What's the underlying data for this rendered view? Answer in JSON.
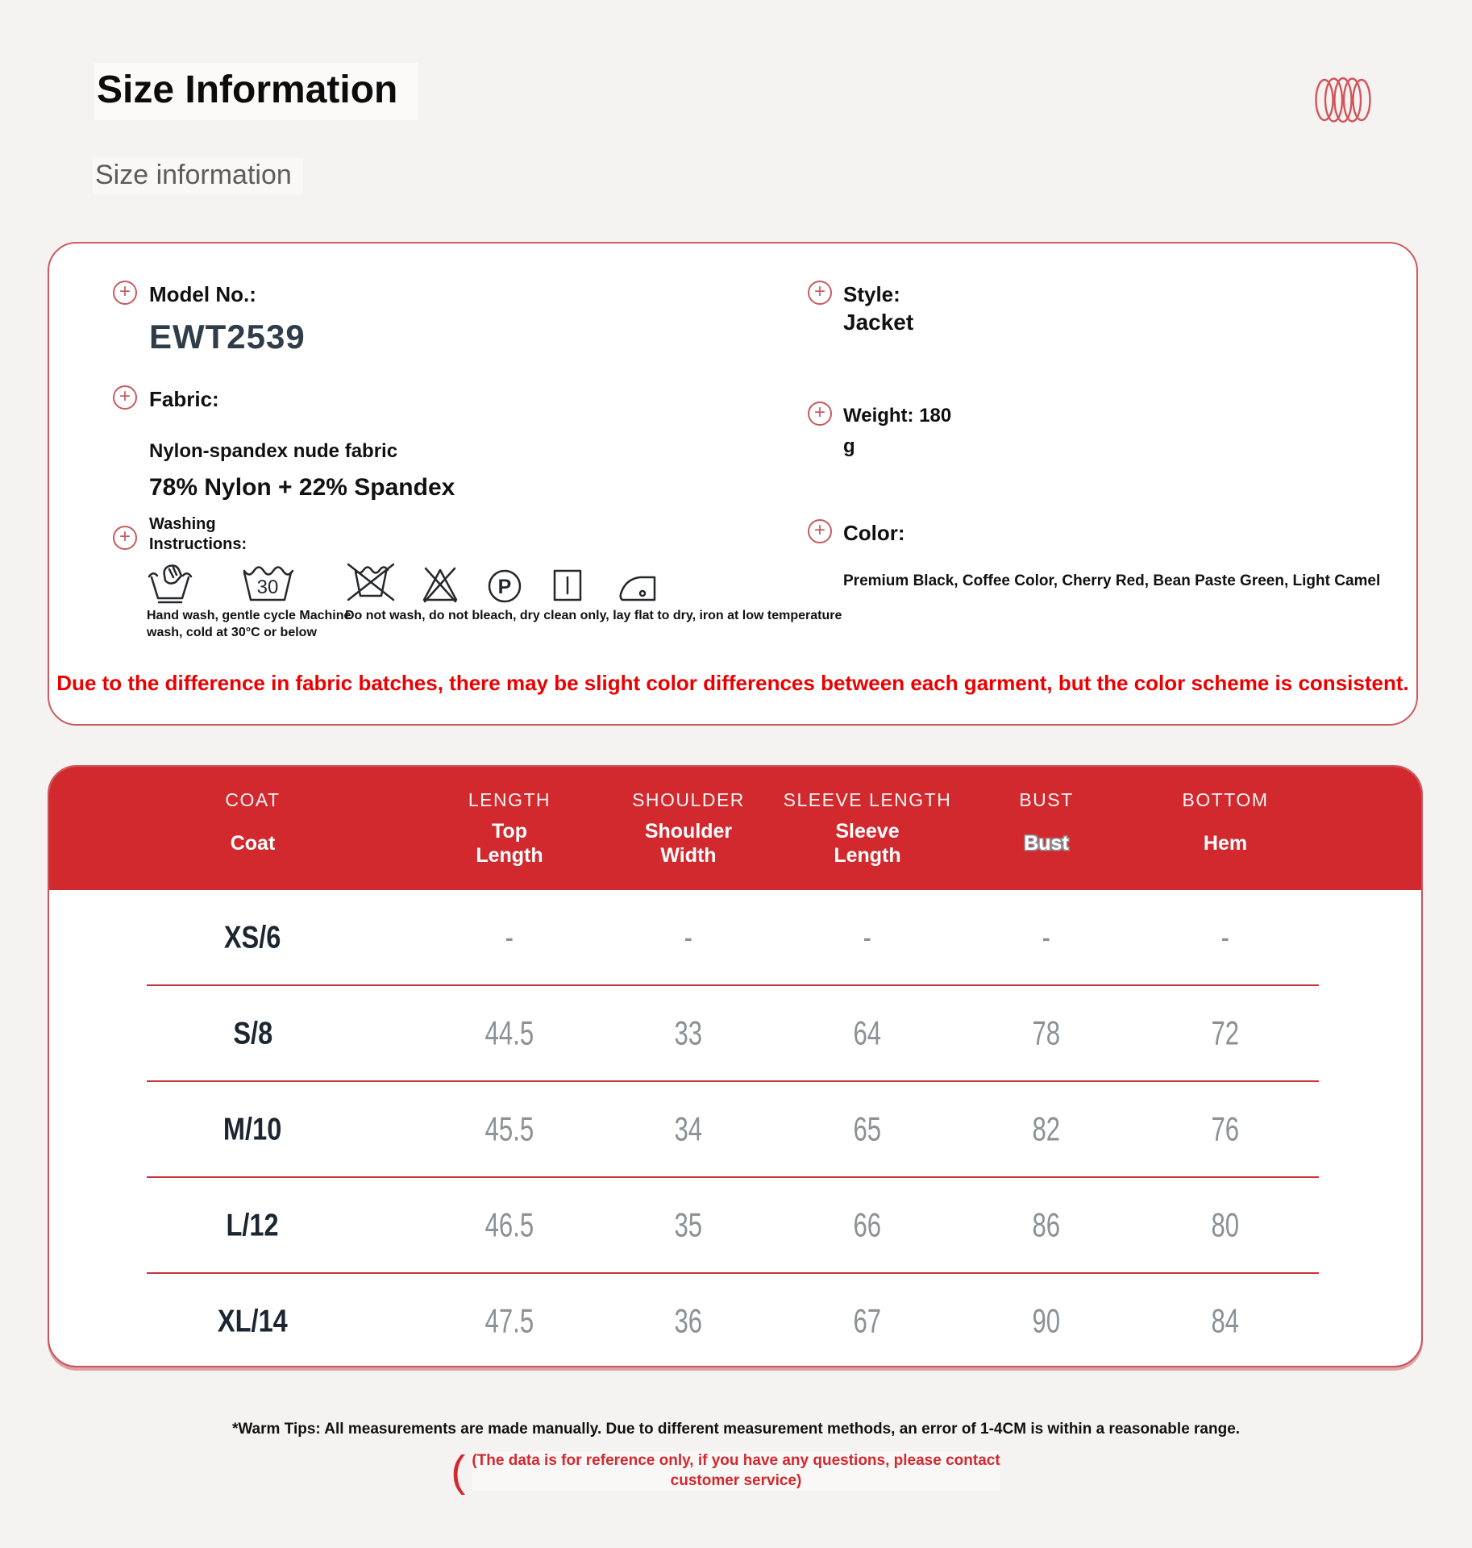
{
  "header": {
    "title": "Size Information",
    "subtitle": "Size information",
    "logo_icon": "coil-logo-icon"
  },
  "icons": {
    "plus": "+",
    "washing_icon_names": [
      "hand-wash-icon",
      "machine-wash-30-icon",
      "do-not-wash-icon",
      "do-not-bleach-icon",
      "dry-clean-p-icon",
      "drip-dry-icon",
      "iron-low-temp-icon"
    ]
  },
  "product_info": {
    "model": {
      "label": "Model No.:",
      "value": "EWT2539"
    },
    "style": {
      "label": "Style:",
      "value": "Jacket"
    },
    "fabric": {
      "label": "Fabric:",
      "description": "Nylon-spandex nude fabric",
      "composition": "78% Nylon + 22% Spandex"
    },
    "weight": {
      "label": "Weight: 180",
      "unit": "g"
    },
    "washing": {
      "label": "Washing Instructions:",
      "machine_wash_temp": "30",
      "dry_clean_letter": "P",
      "caption_left": "Hand wash, gentle cycle Machine wash, cold at 30°C or below",
      "caption_right": "Do not wash, do not bleach, dry clean only, lay flat to dry, iron at low temperature"
    },
    "color": {
      "label": "Color:",
      "value": "Premium Black, Coffee Color, Cherry Red, Bean Paste Green, Light Camel"
    },
    "disclaimer": "Due to the difference in fabric batches, there may be slight color differences between each garment, but the color scheme is consistent."
  },
  "size_table": {
    "columns": [
      {
        "en": "COAT",
        "sub": "Coat"
      },
      {
        "en": "LENGTH",
        "sub": "Top Length"
      },
      {
        "en": "SHOULDER",
        "sub": "Shoulder Width"
      },
      {
        "en": "SLEEVE LENGTH",
        "sub": "Sleeve Length"
      },
      {
        "en": "BUST",
        "sub": "Bust"
      },
      {
        "en": "BOTTOM",
        "sub": "Hem"
      }
    ],
    "rows": [
      {
        "size": "XS/6",
        "values": [
          "-",
          "-",
          "-",
          "-",
          "-"
        ]
      },
      {
        "size": "S/8",
        "values": [
          "44.5",
          "33",
          "64",
          "78",
          "72"
        ]
      },
      {
        "size": "M/10",
        "values": [
          "45.5",
          "34",
          "65",
          "82",
          "76"
        ]
      },
      {
        "size": "L/12",
        "values": [
          "46.5",
          "35",
          "66",
          "86",
          "80"
        ]
      },
      {
        "size": "XL/14",
        "values": [
          "47.5",
          "36",
          "67",
          "90",
          "84"
        ]
      }
    ]
  },
  "footer": {
    "warm_tips": "*Warm Tips: All measurements are made manually. Due to different measurement methods, an error of 1-4CM is within a reasonable range.",
    "decor_paren": "(",
    "note_line1": "(The data is for reference only, if you have any questions, please contact",
    "note_line2": "customer service)"
  },
  "colors": {
    "header_red": "#D2292F",
    "border_rose": "#C9545A",
    "alert_red": "#EB0000",
    "note_red": "#D3282F",
    "value_gray": "#8C9196",
    "label_dark": "#1B2631",
    "page_bg": "#F5F3F1"
  }
}
